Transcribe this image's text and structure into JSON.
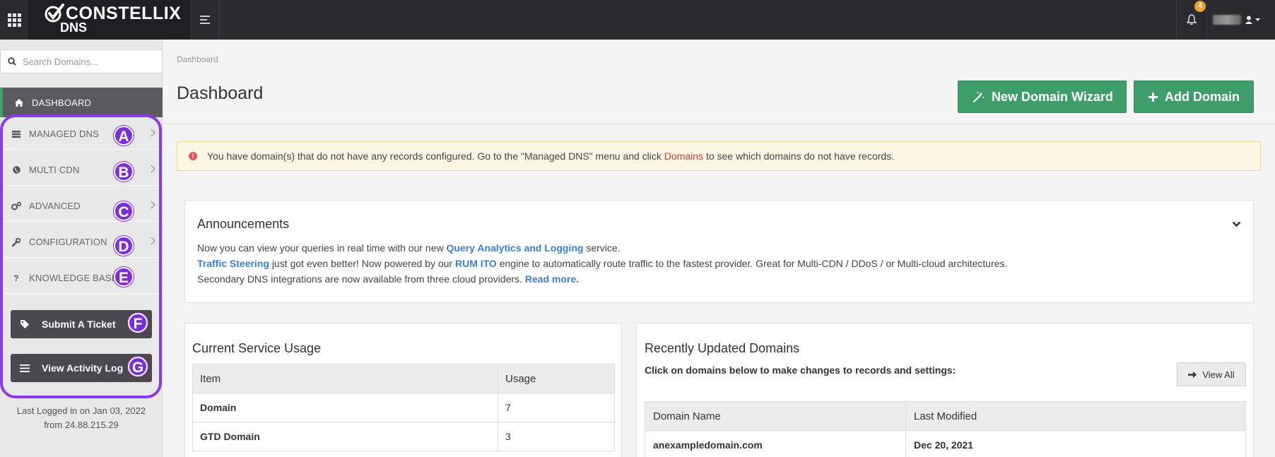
{
  "header": {
    "logo_brand": "CONSTELLIX",
    "logo_product": "DNS",
    "notification_count": "4"
  },
  "sidebar": {
    "search_placeholder": "Search Domains...",
    "items": [
      {
        "label": "DASHBOARD",
        "icon": "home-icon"
      },
      {
        "label": "MANAGED DNS",
        "icon": "server-icon",
        "badge": "A"
      },
      {
        "label": "MULTI CDN",
        "icon": "globe-icon",
        "badge": "B"
      },
      {
        "label": "ADVANCED",
        "icon": "gears-icon",
        "badge": "C"
      },
      {
        "label": "CONFIGURATION",
        "icon": "wrench-icon",
        "badge": "D"
      },
      {
        "label": "KNOWLEDGE BASE",
        "icon": "question-icon",
        "badge": "E"
      }
    ],
    "buttons": [
      {
        "label": "Submit A Ticket",
        "icon": "tag-icon",
        "badge": "F"
      },
      {
        "label": "View Activity Log",
        "icon": "list-icon",
        "badge": "G"
      }
    ],
    "last_login_line1": "Last Logged in on Jan 03, 2022",
    "last_login_line2": "from 24.88.215.29"
  },
  "main": {
    "breadcrumb": "Dashboard",
    "title": "Dashboard",
    "new_domain_wizard": "New Domain Wizard",
    "add_domain": "Add Domain",
    "alert": {
      "text_before": "You have domain(s) that do not have any records configured. Go to the \"Managed DNS\" menu and click",
      "link": "Domains",
      "text_after": "to see which domains do not have records."
    },
    "announcements": {
      "title": "Announcements",
      "line1_before": "Now you can view your queries in real time with our new",
      "line1_link": "Query Analytics and Logging",
      "line1_after": "service.",
      "line2_link1": "Traffic Steering",
      "line2_mid": "just got even better! Now powered by our",
      "line2_link2": "RUM ITO",
      "line2_after": "engine to automatically route traffic to the fastest provider. Great for Multi-CDN / DDoS / or Multi-cloud architectures.",
      "line3_before": "Secondary DNS integrations are now available from three cloud providers.",
      "line3_link": "Read more."
    },
    "usage": {
      "title": "Current Service Usage",
      "columns": [
        "Item",
        "Usage"
      ],
      "rows": [
        {
          "item": "Domain",
          "usage": "7"
        },
        {
          "item": "GTD Domain",
          "usage": "3"
        }
      ]
    },
    "recent": {
      "title": "Recently Updated Domains",
      "subtitle": "Click on domains below to make changes to records and settings:",
      "view_all": "View All",
      "columns": [
        "Domain Name",
        "Last Modified"
      ],
      "rows": [
        {
          "domain": "anexampledomain.com",
          "modified": "Dec 20, 2021"
        }
      ]
    }
  },
  "colors": {
    "topbar": "#2b2b2e",
    "green": "#3e9e6a",
    "annotation_purple": "#8a3ae6",
    "link_blue": "#3b7fd4",
    "alert_link_red": "#d9343a"
  }
}
